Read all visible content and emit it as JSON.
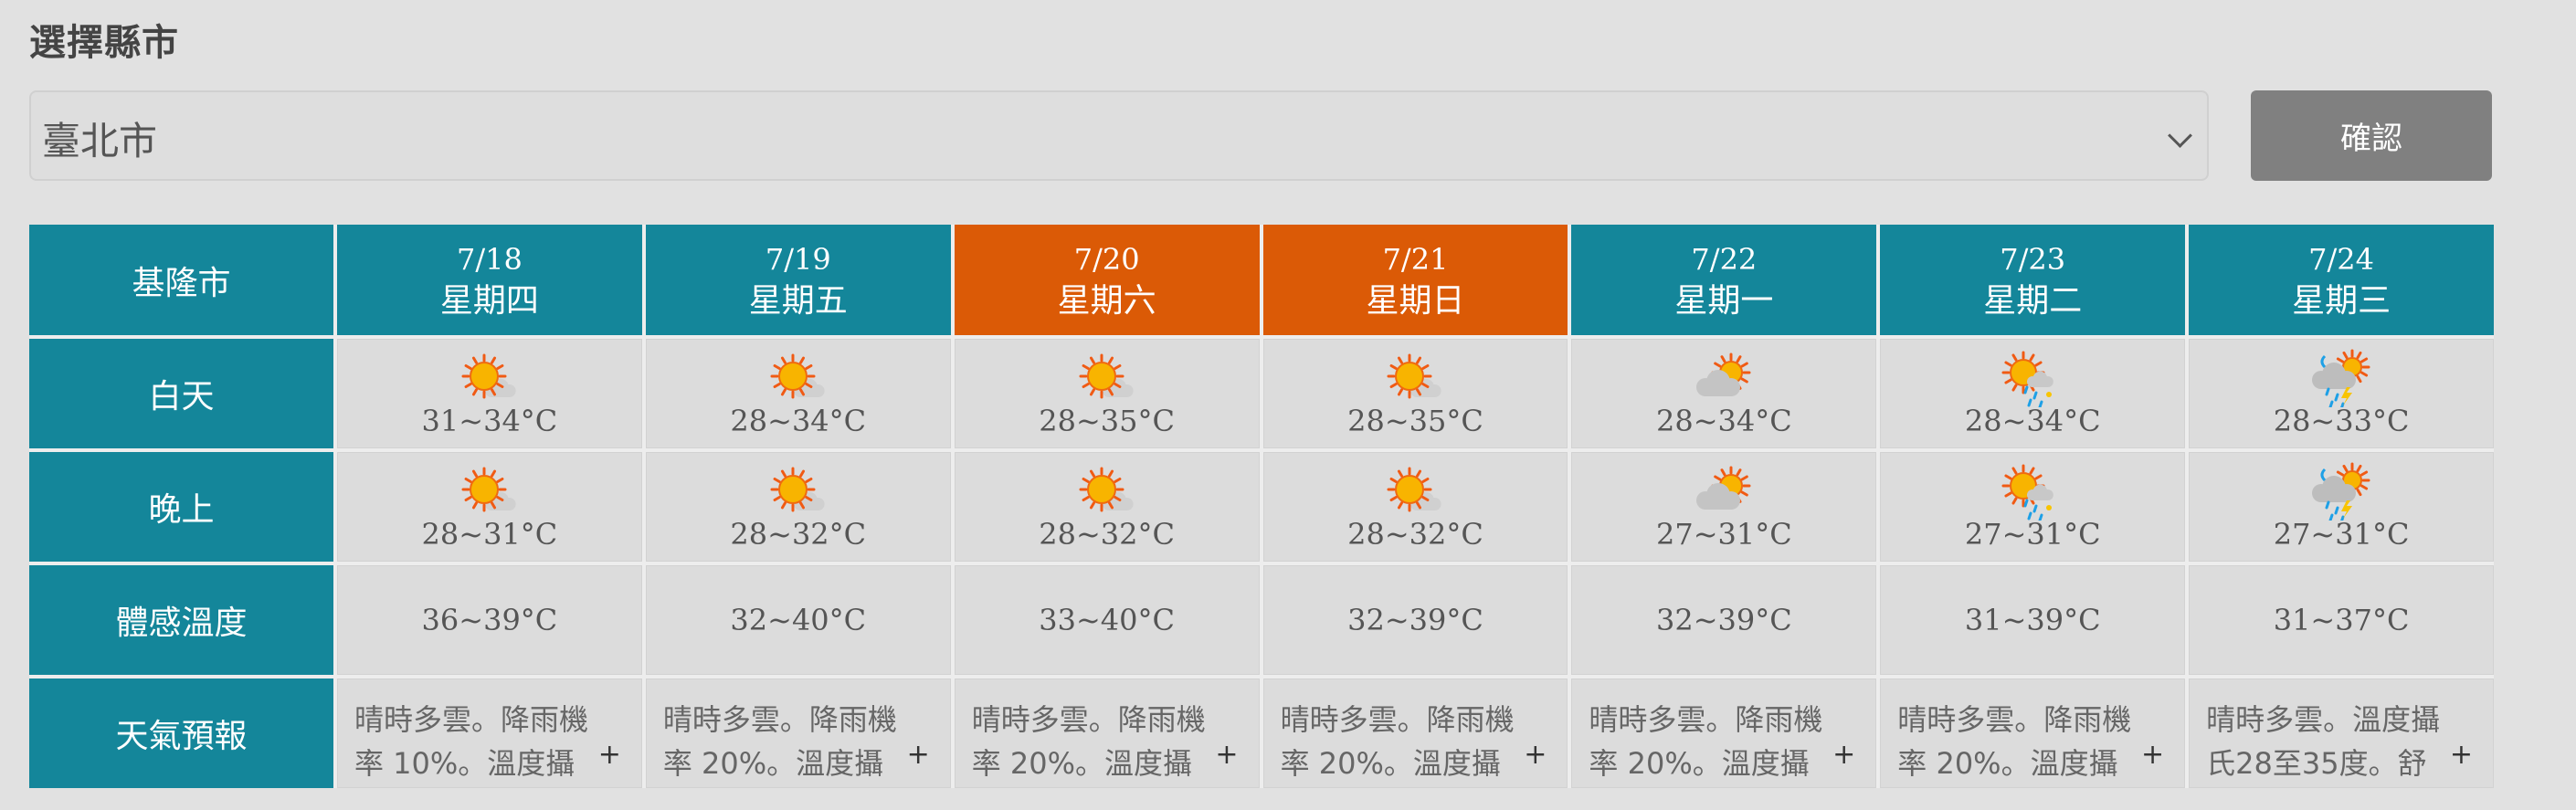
{
  "page": {
    "title": "選擇縣市",
    "select_value": "臺北市",
    "confirm_label": "確認"
  },
  "colors": {
    "header": "#14869a",
    "weekend": "#db5a06",
    "confirm": "#808080"
  },
  "table": {
    "city": "基隆市",
    "row_labels": [
      "白天",
      "晚上",
      "體感溫度",
      "天氣預報"
    ],
    "days": [
      {
        "date": "7/18",
        "weekday": "星期四",
        "weekend": false,
        "day_icon": "sun-icon",
        "day_temp": "31~34°C",
        "night_icon": "sun-icon",
        "night_temp": "28~31°C",
        "feel": "36~39°C",
        "forecast": "晴時多雲。降雨機率 10%。溫度攝"
      },
      {
        "date": "7/19",
        "weekday": "星期五",
        "weekend": false,
        "day_icon": "sun-icon",
        "day_temp": "28~34°C",
        "night_icon": "sun-icon",
        "night_temp": "28~32°C",
        "feel": "32~40°C",
        "forecast": "晴時多雲。降雨機率 20%。溫度攝"
      },
      {
        "date": "7/20",
        "weekday": "星期六",
        "weekend": true,
        "day_icon": "sun-icon",
        "day_temp": "28~35°C",
        "night_icon": "sun-icon",
        "night_temp": "28~32°C",
        "feel": "33~40°C",
        "forecast": "晴時多雲。降雨機率 20%。溫度攝"
      },
      {
        "date": "7/21",
        "weekday": "星期日",
        "weekend": true,
        "day_icon": "sun-icon",
        "day_temp": "28~35°C",
        "night_icon": "sun-icon",
        "night_temp": "28~32°C",
        "feel": "32~39°C",
        "forecast": "晴時多雲。降雨機率 20%。溫度攝"
      },
      {
        "date": "7/22",
        "weekday": "星期一",
        "weekend": false,
        "day_icon": "partly-cloudy-icon",
        "day_temp": "28~34°C",
        "night_icon": "partly-cloudy-icon",
        "night_temp": "27~31°C",
        "feel": "32~39°C",
        "forecast": "晴時多雲。降雨機率 20%。溫度攝"
      },
      {
        "date": "7/23",
        "weekday": "星期二",
        "weekend": false,
        "day_icon": "sun-rain-icon",
        "day_temp": "28~34°C",
        "night_icon": "sun-rain-icon",
        "night_temp": "27~31°C",
        "feel": "31~39°C",
        "forecast": "晴時多雲。降雨機率 20%。溫度攝"
      },
      {
        "date": "7/24",
        "weekday": "星期三",
        "weekend": false,
        "day_icon": "thunder-rain-icon",
        "day_temp": "28~33°C",
        "night_icon": "thunder-rain-icon",
        "night_temp": "27~31°C",
        "feel": "31~37°C",
        "forecast": "晴時多雲。溫度攝氏28至35度。舒"
      }
    ],
    "expand_symbol": "+"
  }
}
